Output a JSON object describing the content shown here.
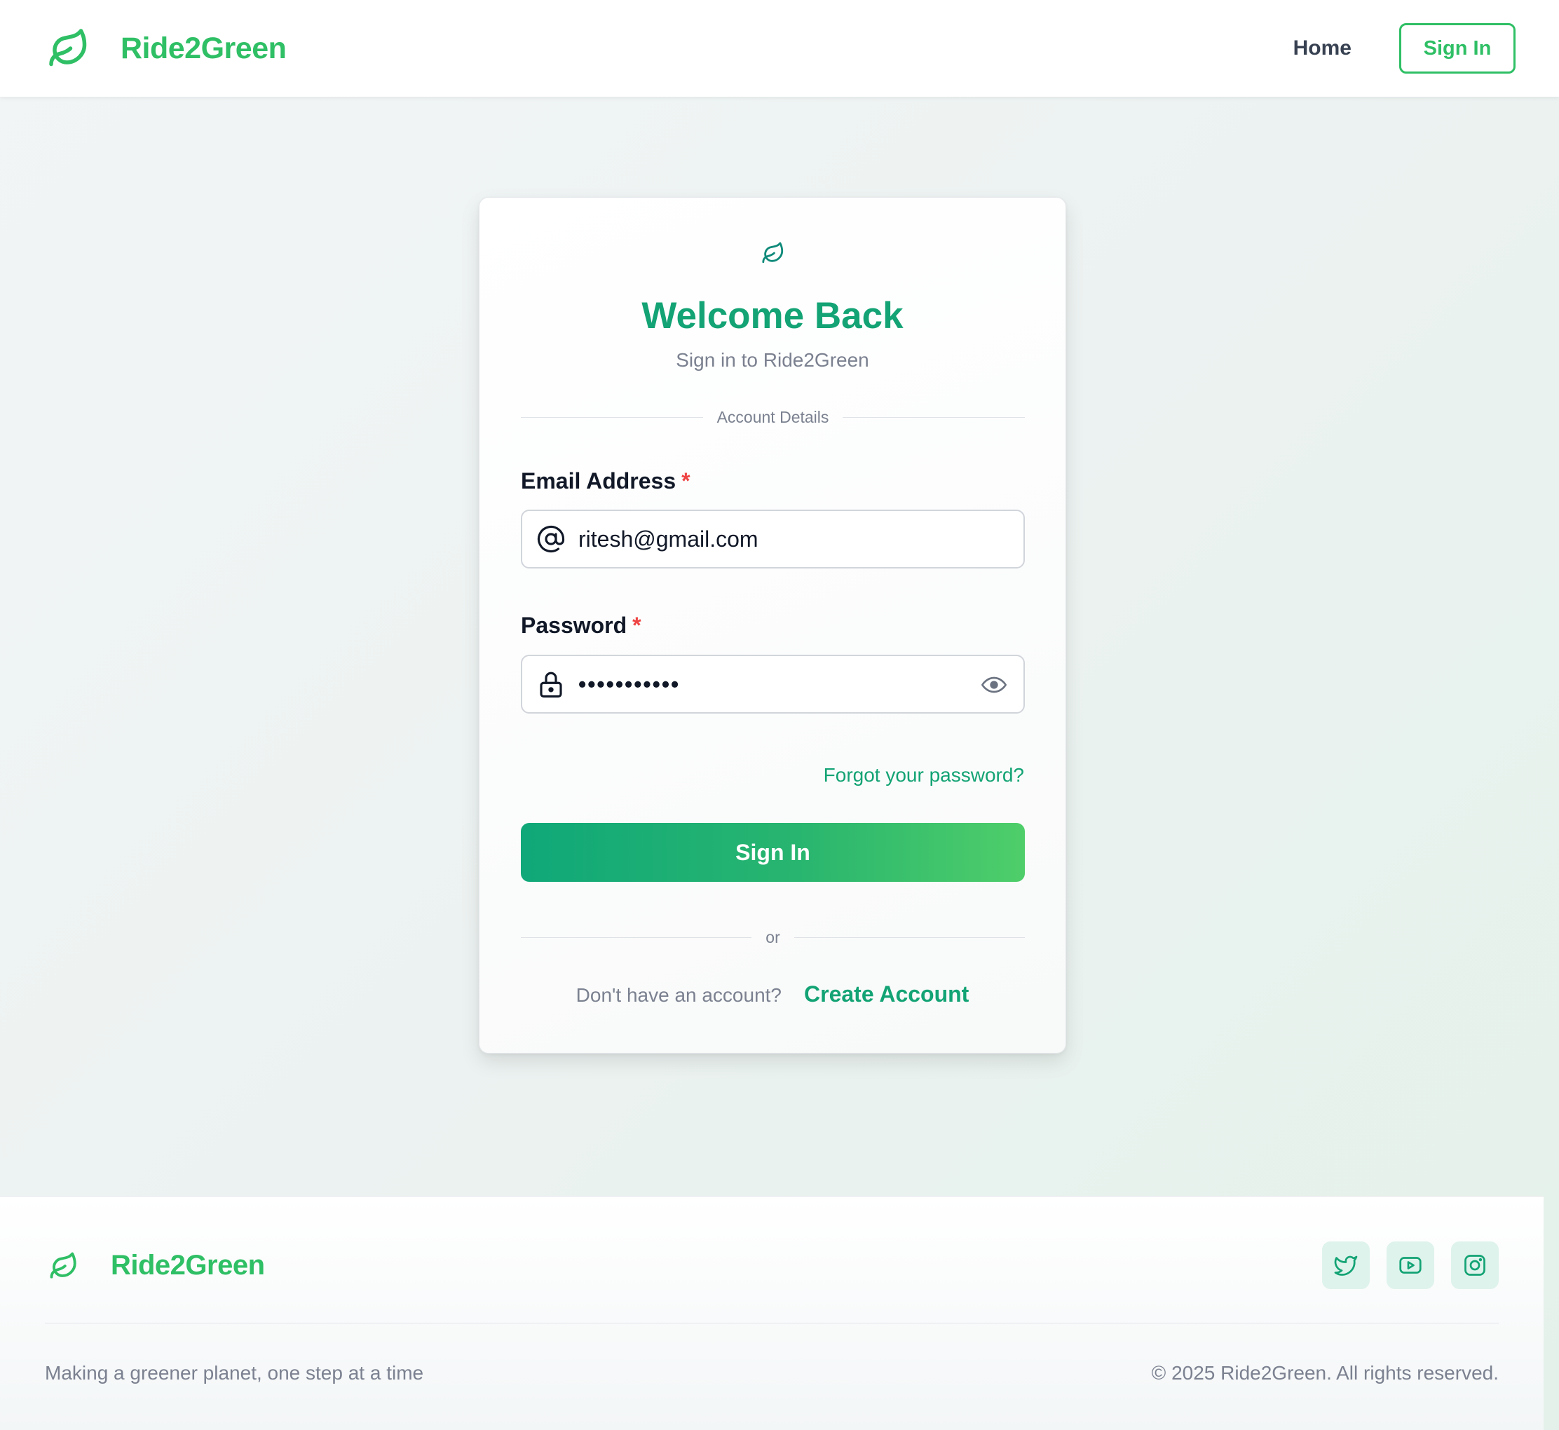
{
  "header": {
    "brand_name": "Ride2Green",
    "nav_home": "Home",
    "nav_signin": "Sign In"
  },
  "card": {
    "title": "Welcome Back",
    "subtitle": "Sign in to Ride2Green",
    "section_label": "Account Details",
    "email_label": "Email Address",
    "required_mark": "*",
    "email_value": "ritesh@gmail.com",
    "password_label": "Password",
    "password_masked": "•••••••••••",
    "forgot_link": "Forgot your password?",
    "submit_label": "Sign In",
    "or_label": "or",
    "signup_prompt": "Don't have an account?",
    "signup_link": "Create Account"
  },
  "footer": {
    "brand_name": "Ride2Green",
    "tagline": "Making a greener planet, one step at a time",
    "copyright": "© 2025 Ride2Green. All rights reserved.",
    "socials": [
      "twitter-icon",
      "youtube-icon",
      "instagram-icon"
    ]
  },
  "colors": {
    "brand_green": "#2fbf65",
    "accent_teal": "#13a374",
    "required_red": "#ef4444"
  }
}
